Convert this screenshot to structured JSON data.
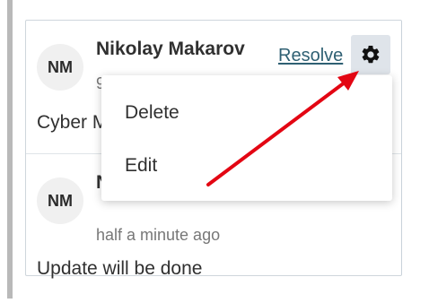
{
  "comments": [
    {
      "avatar_initials": "NM",
      "author": "Nikolay Makarov",
      "time": "9",
      "body": "Cyber M"
    },
    {
      "avatar_initials": "NM",
      "author": "N",
      "time": "half a minute ago",
      "body": "Update will be done"
    }
  ],
  "actions": {
    "resolve_label": "Resolve",
    "gear_icon": "gear-icon"
  },
  "menu": {
    "items": [
      {
        "label": "Delete"
      },
      {
        "label": "Edit"
      }
    ]
  },
  "colors": {
    "arrow": "#e30613",
    "link": "#2f6073",
    "gear_bg": "#dfe4ea",
    "left_bar": "#b9b9b9"
  }
}
